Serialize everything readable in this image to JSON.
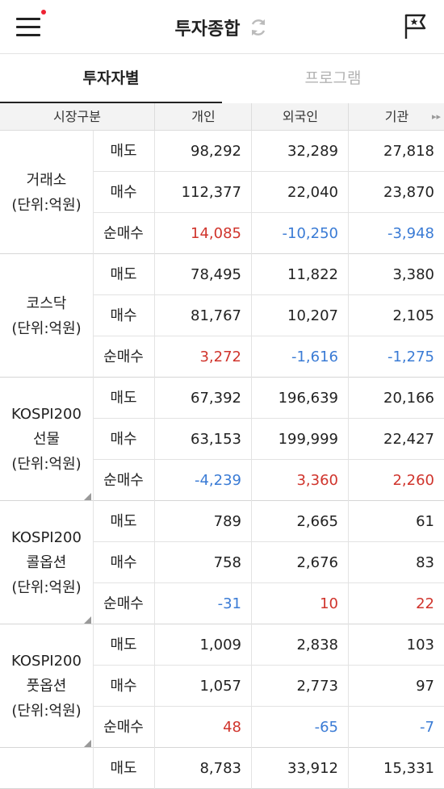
{
  "header": {
    "title": "투자종합"
  },
  "tabs": [
    {
      "label": "투자자별"
    },
    {
      "label": "프로그램"
    }
  ],
  "table": {
    "columns": [
      "시장구분",
      "개인",
      "외국인",
      "기관"
    ],
    "groups": [
      {
        "label_lines": [
          "거래소",
          "(단위:억원)"
        ],
        "corner": false,
        "rows": [
          {
            "type": "매도",
            "values": [
              "98,292",
              "32,289",
              "27,818"
            ],
            "colors": [
              "",
              "",
              ""
            ]
          },
          {
            "type": "매수",
            "values": [
              "112,377",
              "22,040",
              "23,870"
            ],
            "colors": [
              "",
              "",
              ""
            ]
          },
          {
            "type": "순매수",
            "values": [
              "14,085",
              "-10,250",
              "-3,948"
            ],
            "colors": [
              "red",
              "blue",
              "blue"
            ]
          }
        ]
      },
      {
        "label_lines": [
          "코스닥",
          "(단위:억원)"
        ],
        "corner": false,
        "rows": [
          {
            "type": "매도",
            "values": [
              "78,495",
              "11,822",
              "3,380"
            ],
            "colors": [
              "",
              "",
              ""
            ]
          },
          {
            "type": "매수",
            "values": [
              "81,767",
              "10,207",
              "2,105"
            ],
            "colors": [
              "",
              "",
              ""
            ]
          },
          {
            "type": "순매수",
            "values": [
              "3,272",
              "-1,616",
              "-1,275"
            ],
            "colors": [
              "red",
              "blue",
              "blue"
            ]
          }
        ]
      },
      {
        "label_lines": [
          "KOSPI200",
          "선물",
          "(단위:억원)"
        ],
        "corner": true,
        "rows": [
          {
            "type": "매도",
            "values": [
              "67,392",
              "196,639",
              "20,166"
            ],
            "colors": [
              "",
              "",
              ""
            ]
          },
          {
            "type": "매수",
            "values": [
              "63,153",
              "199,999",
              "22,427"
            ],
            "colors": [
              "",
              "",
              ""
            ]
          },
          {
            "type": "순매수",
            "values": [
              "-4,239",
              "3,360",
              "2,260"
            ],
            "colors": [
              "blue",
              "red",
              "red"
            ]
          }
        ]
      },
      {
        "label_lines": [
          "KOSPI200",
          "콜옵션",
          "(단위:억원)"
        ],
        "corner": true,
        "rows": [
          {
            "type": "매도",
            "values": [
              "789",
              "2,665",
              "61"
            ],
            "colors": [
              "",
              "",
              ""
            ]
          },
          {
            "type": "매수",
            "values": [
              "758",
              "2,676",
              "83"
            ],
            "colors": [
              "",
              "",
              ""
            ]
          },
          {
            "type": "순매수",
            "values": [
              "-31",
              "10",
              "22"
            ],
            "colors": [
              "blue",
              "red",
              "red"
            ]
          }
        ]
      },
      {
        "label_lines": [
          "KOSPI200",
          "풋옵션",
          "(단위:억원)"
        ],
        "corner": true,
        "rows": [
          {
            "type": "매도",
            "values": [
              "1,009",
              "2,838",
              "103"
            ],
            "colors": [
              "",
              "",
              ""
            ]
          },
          {
            "type": "매수",
            "values": [
              "1,057",
              "2,773",
              "97"
            ],
            "colors": [
              "",
              "",
              ""
            ]
          },
          {
            "type": "순매수",
            "values": [
              "48",
              "-65",
              "-7"
            ],
            "colors": [
              "red",
              "blue",
              "blue"
            ]
          }
        ]
      },
      {
        "label_lines": [],
        "corner": false,
        "rows": [
          {
            "type": "매도",
            "values": [
              "8,783",
              "33,912",
              "15,331"
            ],
            "colors": [
              "",
              "",
              ""
            ]
          }
        ]
      }
    ]
  },
  "colors": {
    "up": "#d0342c",
    "down": "#3a7bd5",
    "notification": "#e22233"
  },
  "icons": {
    "menu": "hamburger-menu-icon",
    "refresh": "refresh-icon",
    "bookmark": "flag-star-icon",
    "scroll": "scroll-right-arrow-icon"
  }
}
